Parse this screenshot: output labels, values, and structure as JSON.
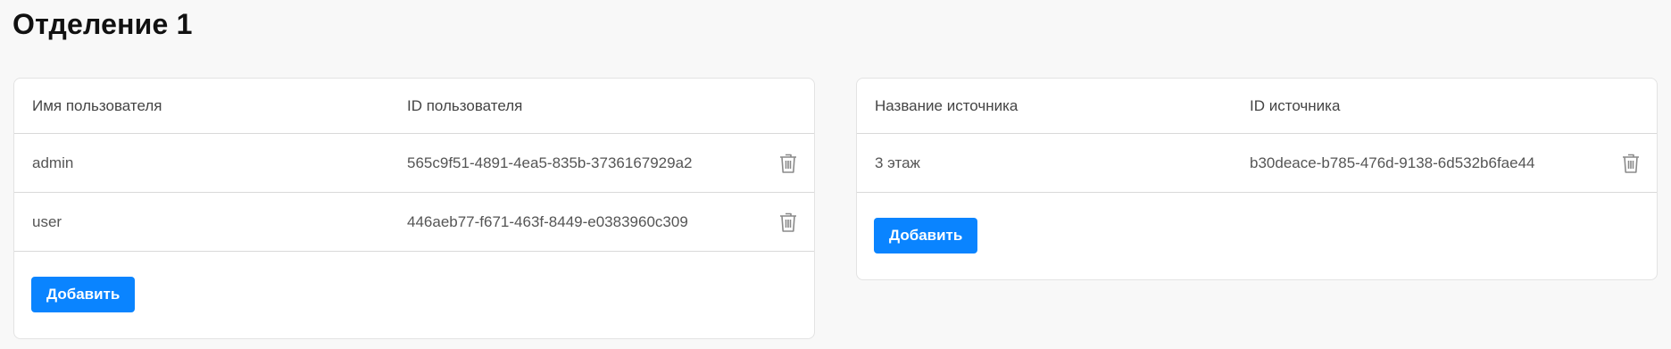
{
  "page": {
    "title": "Отделение 1"
  },
  "users_table": {
    "headers": [
      "Имя пользователя",
      "ID пользователя"
    ],
    "rows": [
      {
        "name": "admin",
        "id": "565c9f51-4891-4ea5-835b-3736167929a2"
      },
      {
        "name": "user",
        "id": "446aeb77-f671-463f-8449-e0383960c309"
      }
    ],
    "add_label": "Добавить"
  },
  "sources_table": {
    "headers": [
      "Название источника",
      "ID источника"
    ],
    "rows": [
      {
        "name": "3 этаж",
        "id": "b30deace-b785-476d-9138-6d532b6fae44"
      }
    ],
    "add_label": "Добавить"
  },
  "icons": {
    "delete": "trash-icon"
  },
  "colors": {
    "accent": "#0a84ff",
    "background": "#f8f8f8",
    "card": "#ffffff",
    "divider": "#d9d9d9"
  }
}
